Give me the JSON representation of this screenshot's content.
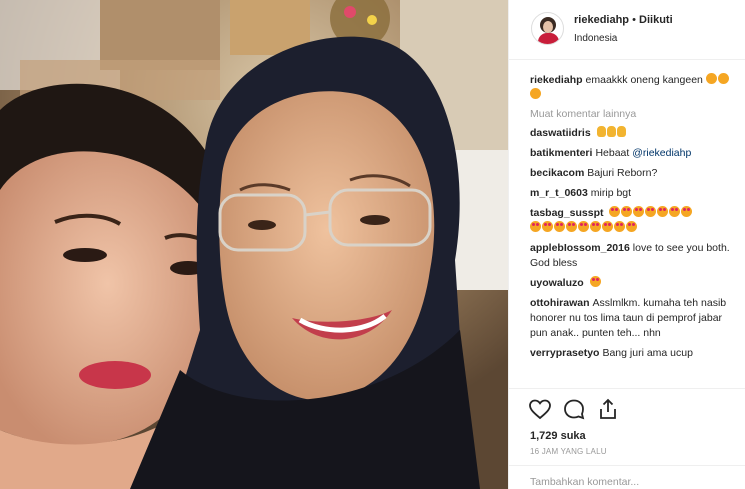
{
  "post": {
    "username": "riekediahp",
    "separator": "•",
    "follow_status": "Diikuti",
    "location": "Indonesia"
  },
  "caption": {
    "username": "riekediahp",
    "text": "emaakkk oneng kangeen"
  },
  "load_more": "Muat komentar lainnya",
  "comments": [
    {
      "username": "daswatiidris",
      "text": ""
    },
    {
      "username": "batikmenteri",
      "text": "Hebaat",
      "mention": "@riekediahp"
    },
    {
      "username": "becikacom",
      "text": "Bajuri Reborn?"
    },
    {
      "username": "m_r_t_0603",
      "text": "mirip bgt"
    },
    {
      "username": "tasbag_susspt",
      "text": ""
    },
    {
      "username": "applebIossom_2016",
      "text": "love to see you both. God bless"
    },
    {
      "username": "uyowaluzo",
      "text": ""
    },
    {
      "username": "ottohirawan",
      "text": "Asslmlkm. kumaha teh nasib honorer nu tos lima taun di pemprof jabar pun anak.. punten teh... nhn"
    },
    {
      "username": "verryprasetyo",
      "text": "Bang juri ama ucup"
    }
  ],
  "likes": "1,729 suka",
  "timestamp": "16 JAM YANG LALU",
  "add_comment_placeholder": "Tambahkan komentar...",
  "icons": {
    "like": "heart-icon",
    "comment": "comment-icon",
    "share": "share-icon"
  },
  "colors": {
    "link": "#003569",
    "muted": "#999999",
    "border": "#efefef"
  }
}
